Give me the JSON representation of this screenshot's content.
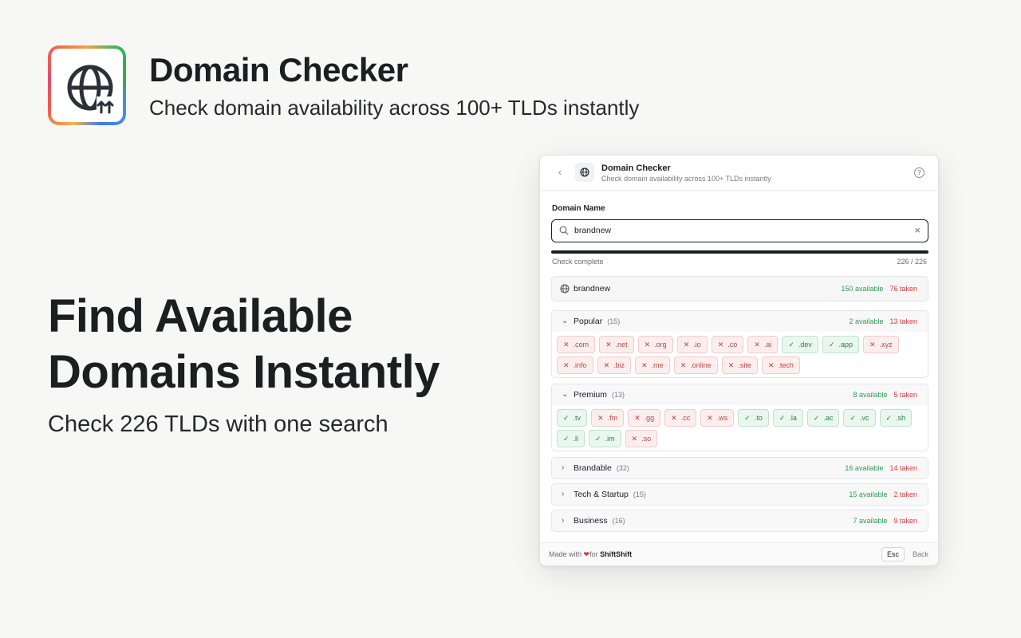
{
  "hero": {
    "title": "Domain Checker",
    "subtitle": "Check domain availability across 100+ TLDs instantly",
    "headline": "Find Available Domains Instantly",
    "tagline": "Check 226 TLDs with one search"
  },
  "panel": {
    "title": "Domain Checker",
    "subtitle": "Check domain availability across 100+ TLDs instantly",
    "field_label": "Domain Name",
    "search_value": "brandnew",
    "progress": {
      "label": "Check complete",
      "done": 226,
      "total": 226,
      "count_text": "226 / 226"
    },
    "summary": {
      "name": "brandnew",
      "available": "150 available",
      "taken": "76 taken"
    },
    "groups": [
      {
        "name": "Popular",
        "count": "(15)",
        "available": "2 available",
        "taken": "13 taken",
        "expanded": true,
        "tlds": [
          {
            "tld": ".com",
            "ok": false
          },
          {
            "tld": ".net",
            "ok": false
          },
          {
            "tld": ".org",
            "ok": false
          },
          {
            "tld": ".io",
            "ok": false
          },
          {
            "tld": ".co",
            "ok": false
          },
          {
            "tld": ".ai",
            "ok": false
          },
          {
            "tld": ".dev",
            "ok": true
          },
          {
            "tld": ".app",
            "ok": true
          },
          {
            "tld": ".xyz",
            "ok": false
          },
          {
            "tld": ".info",
            "ok": false
          },
          {
            "tld": ".biz",
            "ok": false
          },
          {
            "tld": ".me",
            "ok": false
          },
          {
            "tld": ".online",
            "ok": false
          },
          {
            "tld": ".site",
            "ok": false
          },
          {
            "tld": ".tech",
            "ok": false
          }
        ]
      },
      {
        "name": "Premium",
        "count": "(13)",
        "available": "8 available",
        "taken": "5 taken",
        "expanded": true,
        "tlds": [
          {
            "tld": ".tv",
            "ok": true
          },
          {
            "tld": ".fm",
            "ok": false
          },
          {
            "tld": ".gg",
            "ok": false
          },
          {
            "tld": ".cc",
            "ok": false
          },
          {
            "tld": ".ws",
            "ok": false
          },
          {
            "tld": ".to",
            "ok": true
          },
          {
            "tld": ".la",
            "ok": true
          },
          {
            "tld": ".ac",
            "ok": true
          },
          {
            "tld": ".vc",
            "ok": true
          },
          {
            "tld": ".sh",
            "ok": true
          },
          {
            "tld": ".li",
            "ok": true
          },
          {
            "tld": ".im",
            "ok": true
          },
          {
            "tld": ".so",
            "ok": false
          }
        ]
      },
      {
        "name": "Brandable",
        "count": "(32)",
        "available": "16 available",
        "taken": "14 taken",
        "expanded": false,
        "tlds": []
      },
      {
        "name": "Tech & Startup",
        "count": "(15)",
        "available": "15 available",
        "taken": "2 taken",
        "expanded": false,
        "tlds": []
      },
      {
        "name": "Business",
        "count": "(16)",
        "available": "7 available",
        "taken": "9 taken",
        "expanded": false,
        "tlds": []
      }
    ],
    "footer": {
      "made_with": "Made with",
      "for_text": "for",
      "brand": "ShiftShift",
      "esc_key": "Esc",
      "back": "Back"
    }
  },
  "colors": {
    "available": "#2f9d53",
    "taken": "#d23b3b",
    "accent": "#1d1e26"
  }
}
